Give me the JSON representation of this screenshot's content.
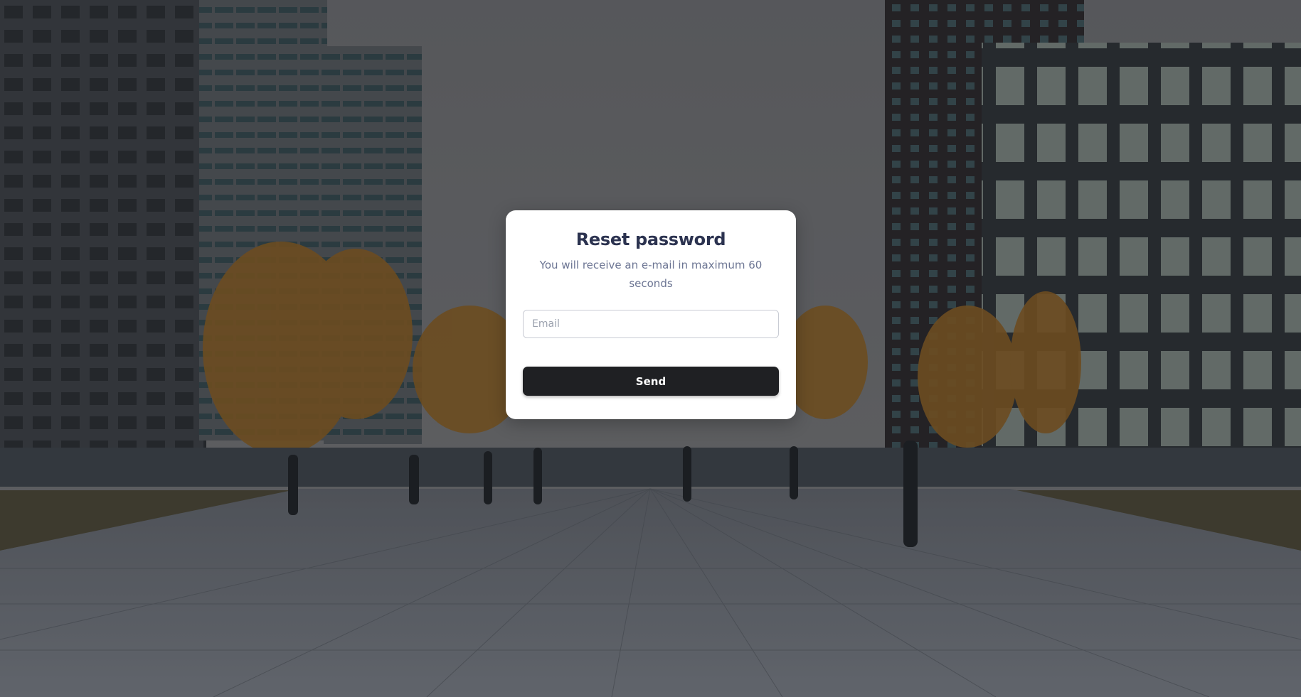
{
  "background": {
    "description_icon": "city-plaza-photo"
  },
  "reset_form": {
    "title": "Reset password",
    "subtitle": "You will receive an e-mail in maximum 60 seconds",
    "email": {
      "value": "",
      "placeholder": "Email"
    },
    "send_label": "Send"
  },
  "colors": {
    "title": "#2c3350",
    "subtitle": "#6c7593",
    "button": "#1f2023",
    "card": "#ffffff"
  }
}
